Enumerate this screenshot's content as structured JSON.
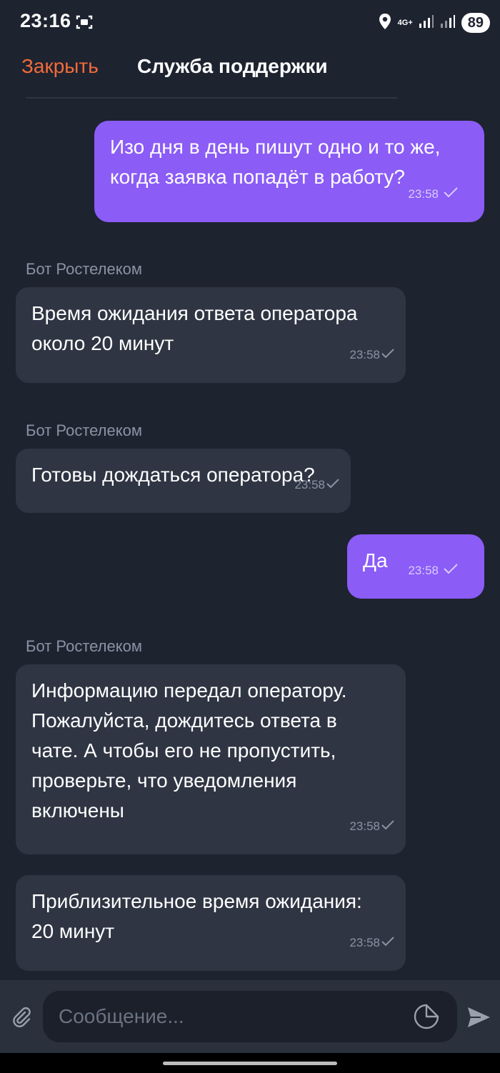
{
  "status_bar": {
    "time": "23:16",
    "network": "4G+",
    "battery": "89"
  },
  "header": {
    "close_label": "Закрыть",
    "title": "Служба поддержки"
  },
  "messages": [
    {
      "side": "out",
      "text": "Изо дня в день пишут одно и то же,\nкогда заявка попадёт в работу?",
      "time": "23:58"
    },
    {
      "side": "in",
      "sender": "Бот Ростелеком",
      "text": "Время ожидания ответа оператора\nоколо 20 минут",
      "time": "23:58"
    },
    {
      "side": "in",
      "sender": "Бот Ростелеком",
      "text": "Готовы дождаться оператора?",
      "time": "23:58"
    },
    {
      "side": "out",
      "text": "Да",
      "time": "23:58"
    },
    {
      "side": "in",
      "sender": "Бот Ростелеком",
      "text": "Информацию передал оператору.\nПожалуйста, дождитесь ответа в\nчате. А чтобы его не пропустить,\nпроверьте, что уведомления\nвключены",
      "time": "23:58"
    },
    {
      "side": "in",
      "text": "Приблизительное время ожидания:\n20 минут",
      "time": "23:58"
    }
  ],
  "composer": {
    "placeholder": "Сообщение..."
  },
  "colors": {
    "background": "#1e2330",
    "accent": "#f26b3a",
    "outgoing_bubble": "#8b5cf6",
    "incoming_bubble": "#2f3543"
  },
  "icons": {
    "screen_record": "screen-record-icon",
    "location": "location-icon",
    "attach": "paperclip-icon",
    "sticker": "sticker-icon",
    "send": "send-icon",
    "read_check": "check-icon"
  }
}
